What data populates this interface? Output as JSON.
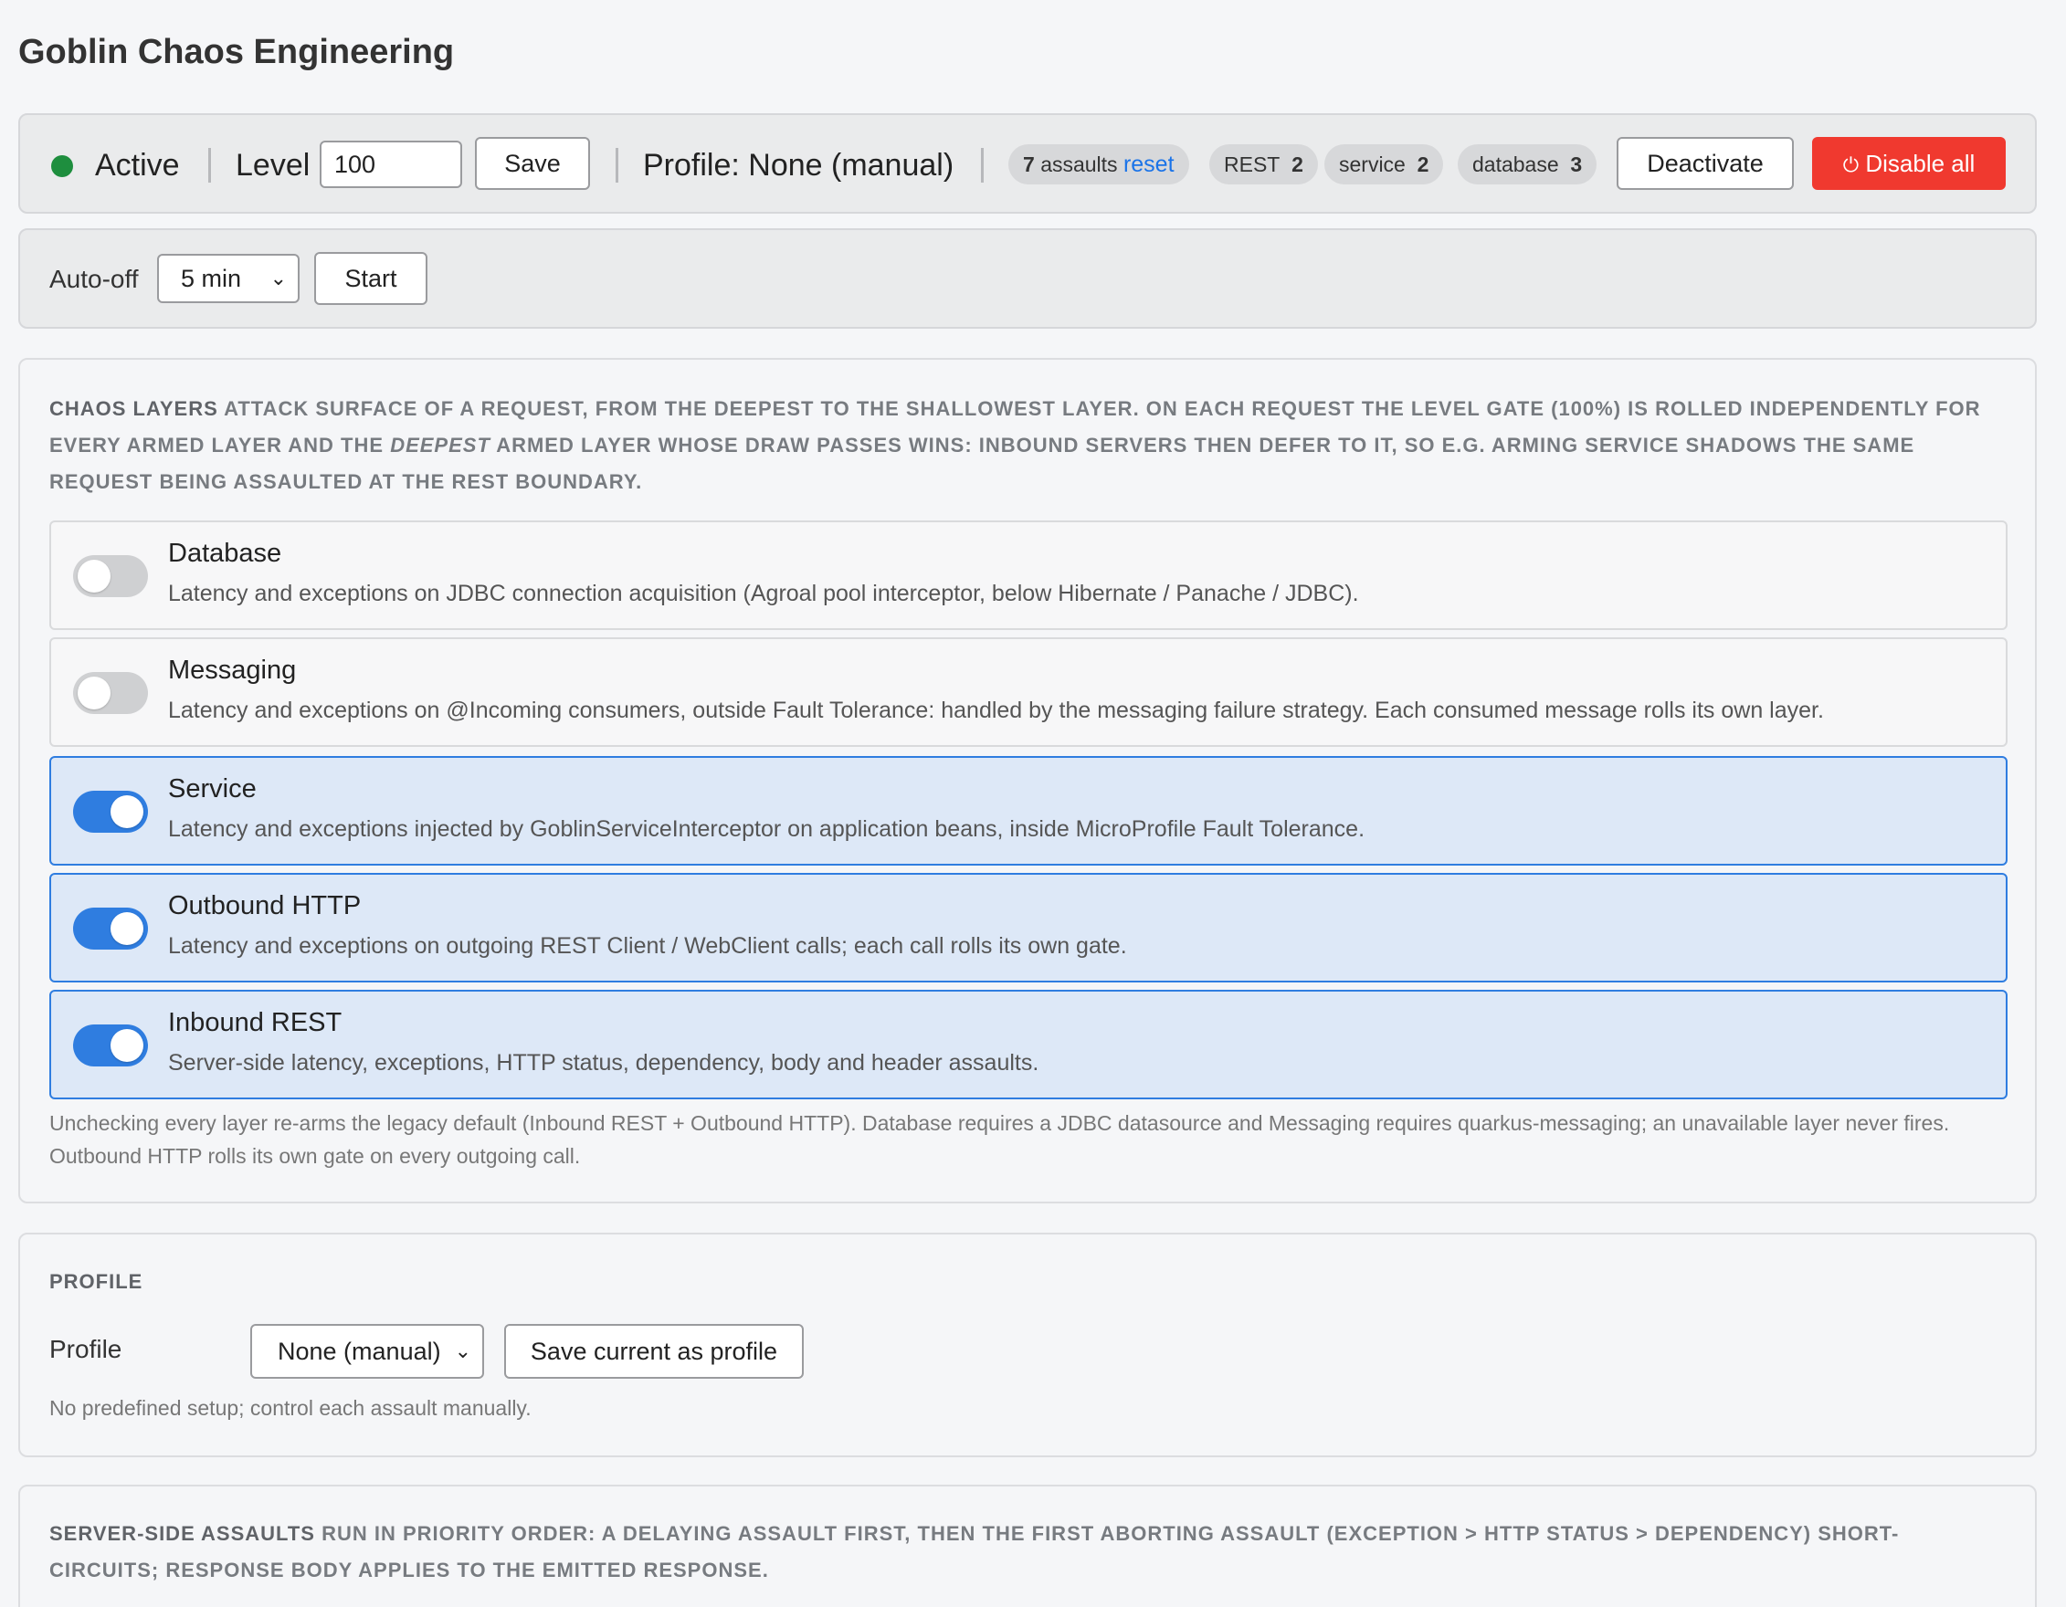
{
  "app": {
    "title": "Goblin Chaos Engineering"
  },
  "status_bar": {
    "status": "Active",
    "status_color": "#1e8e3e",
    "level_label": "Level",
    "level_value": "100",
    "save_label": "Save",
    "profile_text": "Profile: None (manual)",
    "assaults_count": "7",
    "assaults_label": "assaults",
    "reset_label": "reset",
    "chips": [
      {
        "name": "REST",
        "count": "2"
      },
      {
        "name": "service",
        "count": "2"
      },
      {
        "name": "database",
        "count": "3"
      }
    ],
    "deactivate_label": "Deactivate",
    "disable_all_label": "Disable all",
    "disable_icon": "power-icon"
  },
  "autooff": {
    "label": "Auto-off",
    "selected": "5 min",
    "start_label": "Start"
  },
  "layers_section": {
    "title": "Chaos Layers",
    "desc_1": "attack surface of a request, from the deepest to the shallowest layer. On each request the level gate (100%) is rolled independently for every armed layer and the",
    "desc_em": "deepest",
    "desc_2": "armed layer whose draw passes wins: inbound servers then defer to it, so e.g. arming Service shadows the same request being assaulted at the REST boundary.",
    "layers": [
      {
        "title": "Database",
        "desc": "Latency and exceptions on JDBC connection acquisition (Agroal pool interceptor, below Hibernate / Panache / JDBC).",
        "enabled": false
      },
      {
        "title": "Messaging",
        "desc": "Latency and exceptions on @Incoming consumers, outside Fault Tolerance: handled by the messaging failure strategy. Each consumed message rolls its own layer.",
        "enabled": false
      },
      {
        "title": "Service",
        "desc": "Latency and exceptions injected by GoblinServiceInterceptor on application beans, inside MicroProfile Fault Tolerance.",
        "enabled": true
      },
      {
        "title": "Outbound HTTP",
        "desc": "Latency and exceptions on outgoing REST Client / WebClient calls; each call rolls its own gate.",
        "enabled": true
      },
      {
        "title": "Inbound REST",
        "desc": "Server-side latency, exceptions, HTTP status, dependency, body and header assaults.",
        "enabled": true
      }
    ],
    "note_1": "Unchecking every layer re-arms the legacy default (Inbound REST + Outbound HTTP). Database requires a JDBC datasource and Messaging requires quarkus-messaging; an unavailable layer never fires.",
    "note_2": "Outbound HTTP rolls its own gate on every outgoing call."
  },
  "profile_section": {
    "title": "Profile",
    "field_label": "Profile",
    "selected": "None (manual)",
    "save_label": "Save current as profile",
    "hint": "No predefined setup; control each assault manually."
  },
  "server_section": {
    "title": "Server-side assaults",
    "desc_1": "run in priority order: a delaying assault first, then the first aborting assault (exception > HTTP status > dependency) short-",
    "desc_2": "circuits; response body applies to the emitted response."
  },
  "colors": {
    "accent": "#2f7de0",
    "danger": "#f0392f",
    "active": "#1e8e3e"
  }
}
